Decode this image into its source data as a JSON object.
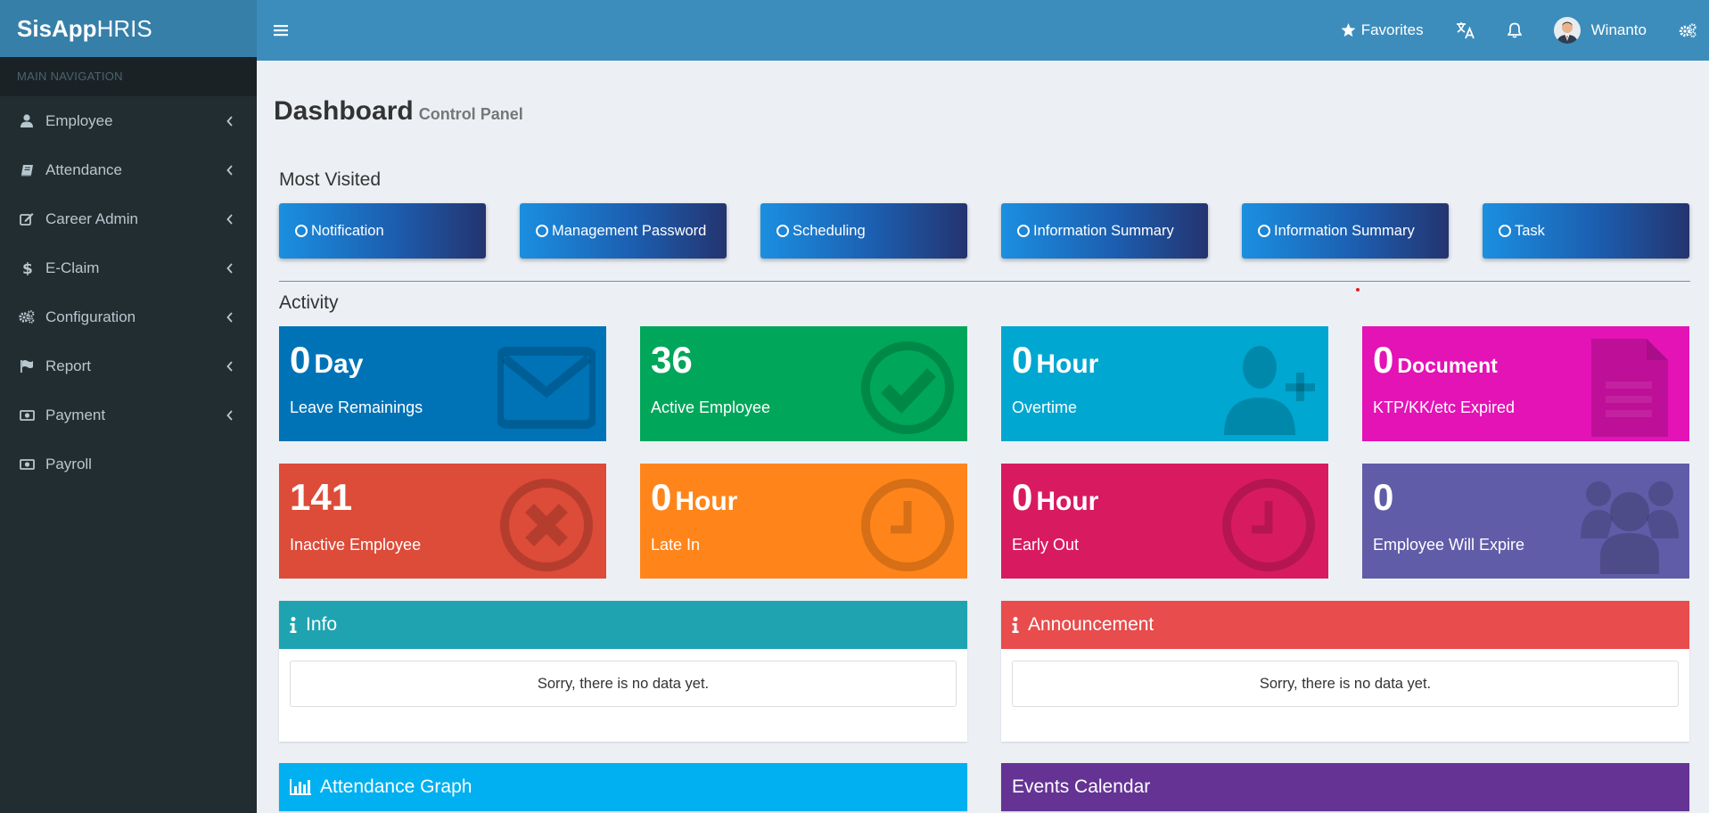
{
  "app": {
    "logo_bold": "SisApp",
    "logo_rest": "HRIS"
  },
  "sidebar": {
    "header": "MAIN NAVIGATION",
    "items": [
      {
        "label": "Employee",
        "icon": "user-icon",
        "has_children": true
      },
      {
        "label": "Attendance",
        "icon": "book-icon",
        "has_children": true
      },
      {
        "label": "Career Admin",
        "icon": "edit-icon",
        "has_children": true
      },
      {
        "label": "E-Claim",
        "icon": "dollar-icon",
        "has_children": true
      },
      {
        "label": "Configuration",
        "icon": "gears-icon",
        "has_children": true
      },
      {
        "label": "Report",
        "icon": "flag-icon",
        "has_children": true
      },
      {
        "label": "Payment",
        "icon": "money-icon",
        "has_children": true
      },
      {
        "label": "Payroll",
        "icon": "money-icon",
        "has_children": false
      }
    ]
  },
  "header": {
    "favorites_label": "Favorites",
    "user_name": "Winanto"
  },
  "page": {
    "title": "Dashboard",
    "subtitle": "Control Panel"
  },
  "most_visited": {
    "label": "Most Visited",
    "items": [
      "Notification",
      "Management Password",
      "Scheduling",
      "Information Summary",
      "Information Summary",
      "Task"
    ]
  },
  "activity": {
    "label": "Activity",
    "cards": [
      {
        "value": "0",
        "unit": "Day",
        "label": "Leave Remainings",
        "color": "#0073b7",
        "icon": "envelope-icon"
      },
      {
        "value": "36",
        "unit": "",
        "label": "Active Employee",
        "color": "#00a65a",
        "icon": "check-circle-icon"
      },
      {
        "value": "0",
        "unit": "Hour",
        "label": "Overtime",
        "color": "#00a7d0",
        "icon": "user-plus-icon"
      },
      {
        "value": "0",
        "unit": "Document",
        "label": "KTP/KK/etc Expired",
        "color": "#e313b6",
        "icon": "file-icon"
      },
      {
        "value": "141",
        "unit": "",
        "label": "Inactive Employee",
        "color": "#dd4b39",
        "icon": "times-circle-icon"
      },
      {
        "value": "0",
        "unit": "Hour",
        "label": "Late In",
        "color": "#ff851b",
        "icon": "clock-icon"
      },
      {
        "value": "0",
        "unit": "Hour",
        "label": "Early Out",
        "color": "#d81b60",
        "icon": "clock-icon"
      },
      {
        "value": "0",
        "unit": "",
        "label": "Employee Will Expire",
        "color": "#605ca8",
        "icon": "users-icon"
      }
    ]
  },
  "panels": {
    "info": {
      "title": "Info",
      "empty_text": "Sorry, there is no data yet.",
      "color": "#1fa3b1"
    },
    "announcement": {
      "title": "Announcement",
      "empty_text": "Sorry, there is no data yet.",
      "color": "#e84c4c"
    },
    "attendance_graph": {
      "title": "Attendance Graph",
      "color": "#00b0f0"
    },
    "events_calendar": {
      "title": "Events Calendar",
      "color": "#643394"
    }
  }
}
